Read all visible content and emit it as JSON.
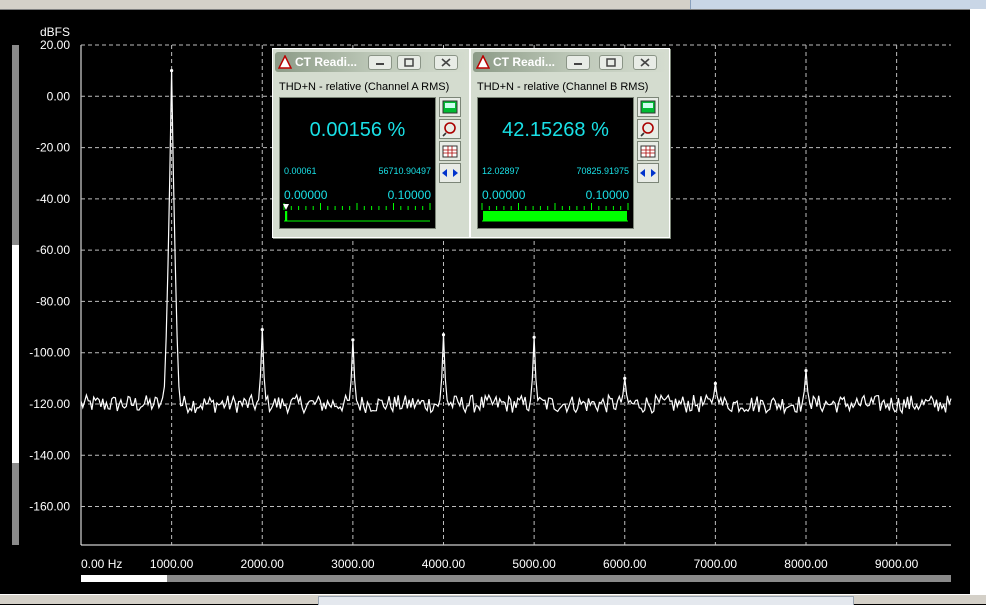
{
  "chart_data": {
    "type": "line",
    "ylabel": "dBFS",
    "ylim": [
      -175,
      20
    ],
    "xlim": [
      0,
      9600
    ],
    "yticks": [
      "20.00",
      "0.00",
      "-20.00",
      "-40.00",
      "-60.00",
      "-80.00",
      "-100.00",
      "-120.00",
      "-140.00",
      "-160.00"
    ],
    "ytick_values": [
      20,
      0,
      -20,
      -40,
      -60,
      -80,
      -100,
      -120,
      -140,
      -160
    ],
    "xticks": [
      "0.00 Hz",
      "1000.00",
      "2000.00",
      "3000.00",
      "4000.00",
      "5000.00",
      "6000.00",
      "7000.00",
      "8000.00",
      "9000.00"
    ],
    "xtick_values": [
      0,
      1000,
      2000,
      3000,
      4000,
      5000,
      6000,
      7000,
      8000,
      9000
    ],
    "grid": true,
    "line_color": "#ffffff",
    "grid_color": "#bdbdbd",
    "noise_floor": -120,
    "peaks": [
      {
        "x": 1000,
        "y": 10
      },
      {
        "x": 2000,
        "y": -91
      },
      {
        "x": 3000,
        "y": -95
      },
      {
        "x": 4000,
        "y": -93
      },
      {
        "x": 5000,
        "y": -94
      },
      {
        "x": 6000,
        "y": -110
      },
      {
        "x": 7000,
        "y": -112
      },
      {
        "x": 8000,
        "y": -107
      }
    ]
  },
  "windows": [
    {
      "title": "CT Readi...",
      "subtitle": "THD+N - relative (Channel A RMS)",
      "value": "0.00156 %",
      "range_min": "0.00061",
      "range_max": "56710.90497",
      "scale_min": "0.00000",
      "scale_max": "0.10000",
      "bar_fraction": 0.0156
    },
    {
      "title": "CT Readi...",
      "subtitle": "THD+N - relative (Channel B RMS)",
      "value": "42.15268 %",
      "range_min": "12.02897",
      "range_max": "70825.91975",
      "scale_min": "0.00000",
      "scale_max": "0.10000",
      "bar_fraction": 1
    }
  ],
  "icons": [
    "cursor-icon",
    "minimize-icon",
    "restore-icon",
    "close-icon",
    "number-format-icon",
    "probe-icon",
    "table-icon",
    "arrows-icon"
  ],
  "colors": {
    "readout": "#19e0e6",
    "bar": "#00ff00",
    "window": "#d4dccf"
  }
}
